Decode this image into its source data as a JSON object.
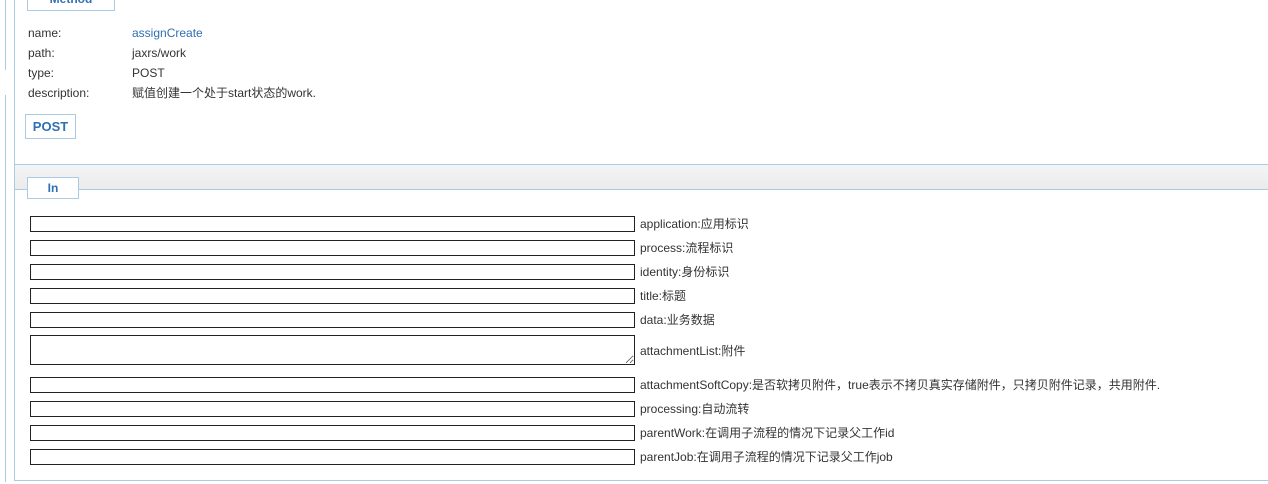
{
  "method": {
    "legend": "Method",
    "fields": [
      {
        "key": "name:",
        "value": "assignCreate"
      },
      {
        "key": "path:",
        "value": "jaxrs/work"
      },
      {
        "key": "type:",
        "value": "POST"
      },
      {
        "key": "description:",
        "value": "赋值创建一个处于start状态的work."
      }
    ],
    "post_button": "POST"
  },
  "in": {
    "legend": "In",
    "params": [
      {
        "label": "application:应用标识"
      },
      {
        "label": "process:流程标识"
      },
      {
        "label": "identity:身份标识"
      },
      {
        "label": "title:标题"
      },
      {
        "label": "data:业务数据"
      },
      {
        "label": "attachmentList:附件"
      },
      {
        "label": "attachmentSoftCopy:是否软拷贝附件，true表示不拷贝真实存储附件，只拷贝附件记录，共用附件."
      },
      {
        "label": "processing:自动流转"
      },
      {
        "label": "parentWork:在调用子流程的情况下记录父工作id"
      },
      {
        "label": "parentJob:在调用子流程的情况下记录父工作job"
      }
    ]
  }
}
